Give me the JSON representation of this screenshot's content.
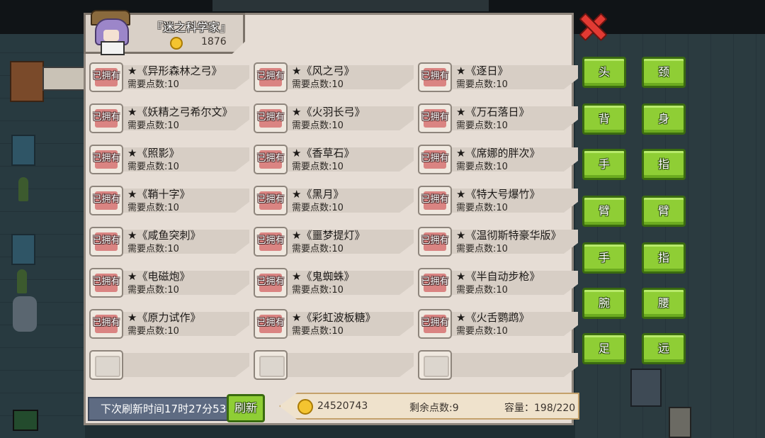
{
  "header": {
    "title": "『迷之科学家』",
    "coins": "1876"
  },
  "items": [
    {
      "name": "★《异形森林之弓》",
      "cost": "需要点数:10",
      "owned": "已拥有"
    },
    {
      "name": "★《风之弓》",
      "cost": "需要点数:10",
      "owned": "已拥有"
    },
    {
      "name": "★《逐日》",
      "cost": "需要点数:10",
      "owned": "已拥有"
    },
    {
      "name": "★《妖精之弓希尔文》",
      "cost": "需要点数:10",
      "owned": "已拥有"
    },
    {
      "name": "★《火羽长弓》",
      "cost": "需要点数:10",
      "owned": "已拥有"
    },
    {
      "name": "★《万石落日》",
      "cost": "需要点数:10",
      "owned": "已拥有"
    },
    {
      "name": "★《照影》",
      "cost": "需要点数:10",
      "owned": "已拥有"
    },
    {
      "name": "★《香草石》",
      "cost": "需要点数:10",
      "owned": "已拥有"
    },
    {
      "name": "★《席娜的胖次》",
      "cost": "需要点数:10",
      "owned": "已拥有"
    },
    {
      "name": "★《鞘十字》",
      "cost": "需要点数:10",
      "owned": "已拥有"
    },
    {
      "name": "★《黑月》",
      "cost": "需要点数:10",
      "owned": "已拥有"
    },
    {
      "name": "★《特大号爆竹》",
      "cost": "需要点数:10",
      "owned": "已拥有"
    },
    {
      "name": "★《咸鱼突刺》",
      "cost": "需要点数:10",
      "owned": "已拥有"
    },
    {
      "name": "★《噩梦提灯》",
      "cost": "需要点数:10",
      "owned": "已拥有"
    },
    {
      "name": "★《温彻斯特豪华版》",
      "cost": "需要点数:10",
      "owned": "已拥有"
    },
    {
      "name": "★《电磁炮》",
      "cost": "需要点数:10",
      "owned": "已拥有"
    },
    {
      "name": "★《鬼蜘蛛》",
      "cost": "需要点数:10",
      "owned": "已拥有"
    },
    {
      "name": "★《半自动步枪》",
      "cost": "需要点数:10",
      "owned": "已拥有"
    },
    {
      "name": "★《原力试作》",
      "cost": "需要点数:10",
      "owned": "已拥有"
    },
    {
      "name": "★《彩虹波板糖》",
      "cost": "需要点数:10",
      "owned": "已拥有"
    },
    {
      "name": "★《火舌鹦鹉》",
      "cost": "需要点数:10",
      "owned": "已拥有"
    }
  ],
  "equip": {
    "left": [
      "头",
      "背",
      "手",
      "臂",
      "手",
      "腕",
      "足"
    ],
    "right": [
      "颈",
      "身",
      "指",
      "臂",
      "指",
      "腰",
      "远"
    ]
  },
  "footer": {
    "refresh_time": "下次刷新时间17时27分53",
    "refresh_btn": "刷新",
    "total_coins": "24520743",
    "points": "剩余点数:9",
    "capacity": "容量：198/220"
  }
}
